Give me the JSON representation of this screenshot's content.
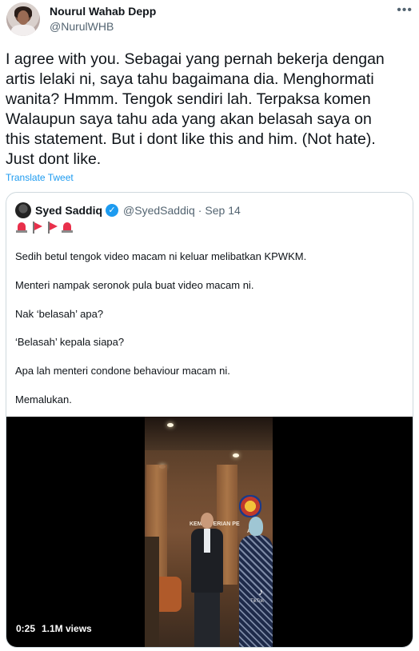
{
  "tweet": {
    "author_name": "Nourul Wahab Depp",
    "author_handle": "@NurulWHB",
    "more_icon": "more-horizontal-icon",
    "text_lines": [
      "I agree with you. Sebagai yang pernah bekerja dengan",
      "artis lelaki ni, saya tahu bagaimana dia. Menghormati",
      "wanita? Hmmm. Tengok sendiri lah. Terpaksa komen",
      "Walaupun saya tahu ada yang akan belasah saya on",
      "this statement. But i dont like this and him. (Not hate).",
      "Just dont like."
    ],
    "translate_label": "Translate Tweet"
  },
  "quote": {
    "author_name": "Syed Saddiq",
    "author_handle": "@SyedSaddiq",
    "separator": "·",
    "date": "Sep 14",
    "verified_icon": "verified-badge-icon",
    "emojis": [
      "police-siren",
      "red-flag",
      "red-flag",
      "police-siren"
    ],
    "lines": [
      "Sedih betul tengok video macam ni keluar melibatkan KPWKM.",
      "Menteri nampak seronok pula buat video macam ni.",
      "Nak ‘belasah’ apa?",
      "‘Belasah’ kepala siapa?",
      "Apa lah menteri condone behaviour macam ni.",
      "Memalukan."
    ],
    "video": {
      "duration": "0:25",
      "views": "1.1M views",
      "sign_lines": [
        "KEMENTERIAN PE",
        "ARG"
      ],
      "watermark": "TikTok"
    }
  },
  "colors": {
    "text": "#0f1419",
    "secondary": "#536471",
    "link": "#1d9bf0",
    "border": "#cfd9de"
  }
}
